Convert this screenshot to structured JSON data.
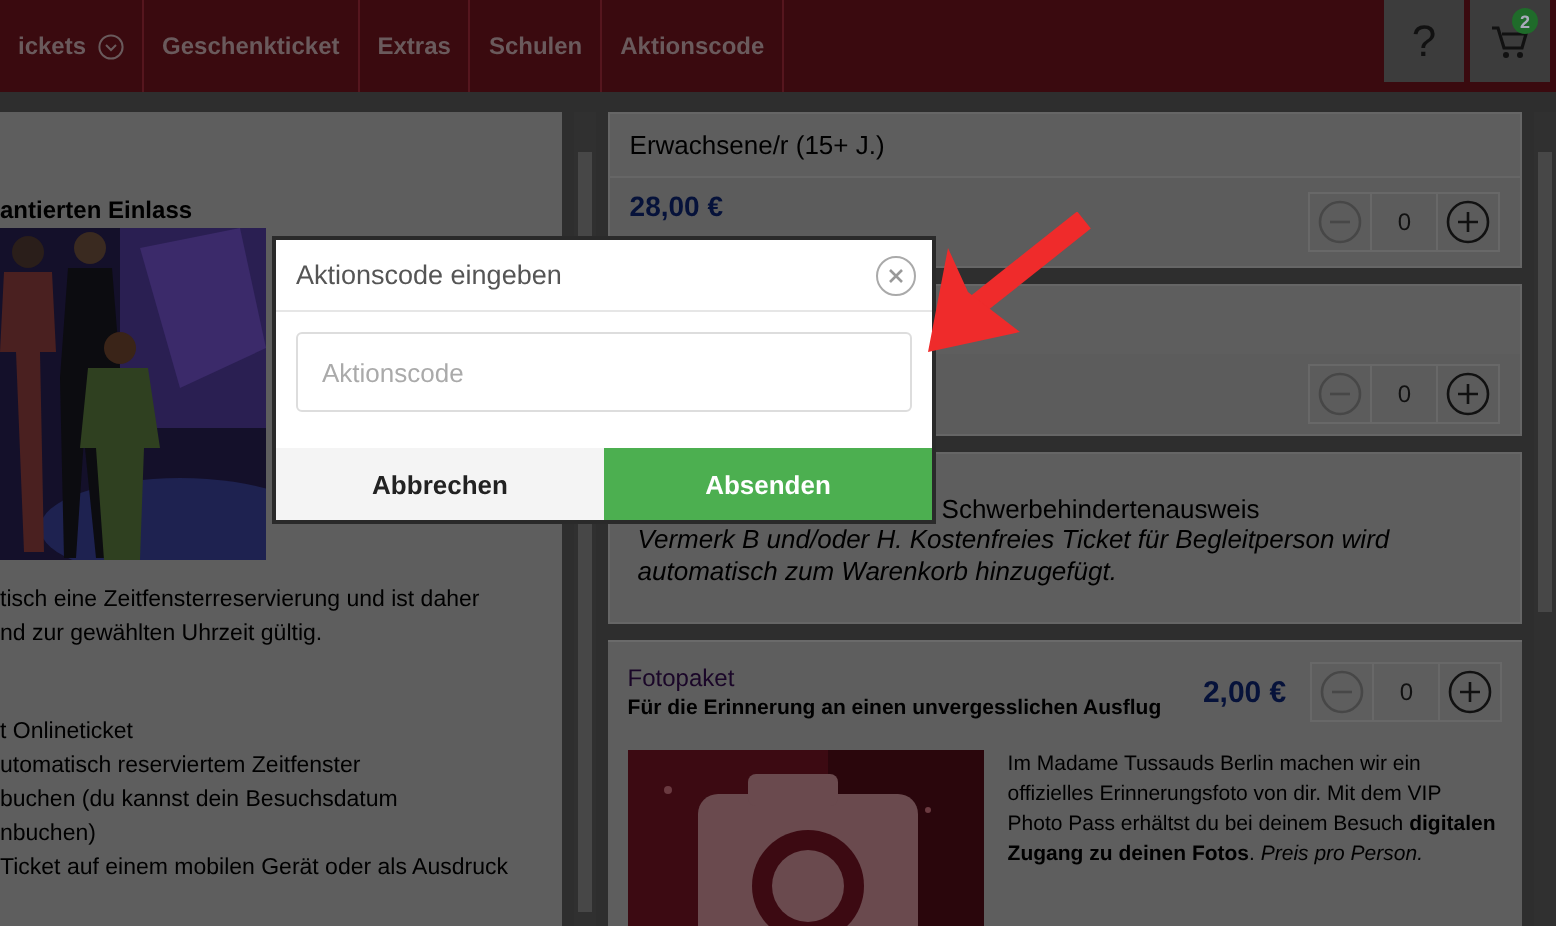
{
  "nav": {
    "items": [
      {
        "label": "ickets",
        "dropdown": true
      },
      {
        "label": "Geschenkticket",
        "dropdown": false
      },
      {
        "label": "Extras",
        "dropdown": false
      },
      {
        "label": "Schulen",
        "dropdown": false
      },
      {
        "label": "Aktionscode",
        "dropdown": false
      }
    ],
    "help": "?",
    "cart_count": "2"
  },
  "info": {
    "heading": "antierten Einlass",
    "intro": [
      "tisch eine Zeitfensterreservierung und ist daher",
      "nd zur gewählten Uhrzeit gültig."
    ],
    "features": [
      "t Onlineticket",
      "utomatisch reserviertem Zeitfenster",
      "buchen (du kannst dein Besuchsdatum",
      "nbuchen)",
      "Ticket auf einem mobilen Gerät oder als Ausdruck"
    ]
  },
  "tickets": [
    {
      "title": "Erwachsene/r (15+ J.)",
      "price": "28,00 €",
      "quantity": "0",
      "decrement_disabled": true
    },
    {
      "quantity": "0",
      "decrement_disabled": true
    },
    {
      "title": "Schwerbehindertenausweis",
      "note": "Vermerk B und/oder H. Kostenfreies Ticket für Begleitperson wird automatisch zum Warenkorb hinzugefügt."
    }
  ],
  "extra": {
    "title": "Fotopaket",
    "subtitle": "Für die Erinnerung an einen unvergesslichen Ausflug",
    "price": "2,00 €",
    "quantity": "0",
    "decrement_disabled": true,
    "description": "Im Madame Tussauds Berlin machen wir ein offizielles Erinnerungsfoto von dir. Mit dem VIP Photo Pass erhältst du bei deinem Besuch **digitalen Zugang zu deinen Fotos**. *Preis pro Person.*"
  },
  "dialog": {
    "title": "Aktionscode eingeben",
    "placeholder": "Aktionscode",
    "buttons": [
      {
        "label": "Abbrechen",
        "kind": "secondary"
      },
      {
        "label": "Absenden",
        "kind": "primary"
      }
    ]
  }
}
